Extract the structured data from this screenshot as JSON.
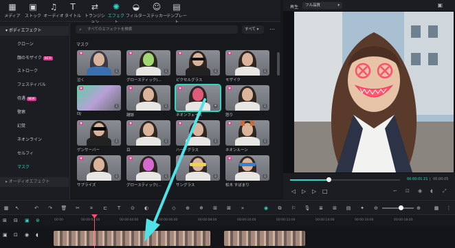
{
  "toolbar": {
    "items": [
      {
        "label": "メディア",
        "icon": "media-icon"
      },
      {
        "label": "ストック",
        "icon": "stock-icon"
      },
      {
        "label": "オーディオ",
        "icon": "audio-icon"
      },
      {
        "label": "タイトル",
        "icon": "title-icon"
      },
      {
        "label": "トランジション",
        "icon": "transition-icon"
      },
      {
        "label": "エフェクト",
        "icon": "effect-icon"
      },
      {
        "label": "フィルター",
        "icon": "filter-icon"
      },
      {
        "label": "ステッカー",
        "icon": "sticker-icon"
      },
      {
        "label": "テンプレート",
        "icon": "template-icon"
      }
    ],
    "active": "エフェクト"
  },
  "sidebar": {
    "header": "ボディエフェクト",
    "items": [
      {
        "label": "クローン"
      },
      {
        "label": "顔のモザイク",
        "badge": "BETA"
      },
      {
        "label": "ストローク"
      },
      {
        "label": "フェスティバル"
      },
      {
        "label": "待遇",
        "badge": "NEW"
      },
      {
        "label": "警察"
      },
      {
        "label": "幻覚"
      },
      {
        "label": "ネオンライン"
      },
      {
        "label": "セルフィ"
      },
      {
        "label": "マスク"
      }
    ],
    "footer": "オーディオエフェクト"
  },
  "search": {
    "placeholder": "すべてのエフェクトを検索",
    "filter": "すべて"
  },
  "section": "マスク",
  "tiles": [
    {
      "label": "泣く"
    },
    {
      "label": "グロースティック(..."
    },
    {
      "label": "ピクセルグラス"
    },
    {
      "label": "モザイク"
    },
    {
      "label": "DJ"
    },
    {
      "label": "雑誌"
    },
    {
      "label": "ネオンフェイス"
    },
    {
      "label": "怒り"
    },
    {
      "label": "ゲンサーバー"
    },
    {
      "label": "目"
    },
    {
      "label": "ハートグラス"
    },
    {
      "label": "ネオンルーン"
    },
    {
      "label": "サプライズ"
    },
    {
      "label": "グロースティック(..."
    },
    {
      "label": "サングラス"
    },
    {
      "label": "松木 すぼまり"
    }
  ],
  "preview": {
    "label": "再生",
    "quality": "フル品質",
    "time_current": "00:00:01:21",
    "time_total": "00:00:05"
  },
  "timeline": {
    "ticks": [
      "00:00",
      "00:00:02:00",
      "00:00:04:00",
      "00:00:06:00",
      "00:00:08:00",
      "00:00:10:00",
      "00:00:12:00",
      "00:00:14:00",
      "00:00:16:00",
      "00:00:18:00"
    ],
    "colors": {
      "accent": "#2fd8c4",
      "playhead": "#ff4d6d",
      "arrow": "#4fe3e8"
    }
  }
}
